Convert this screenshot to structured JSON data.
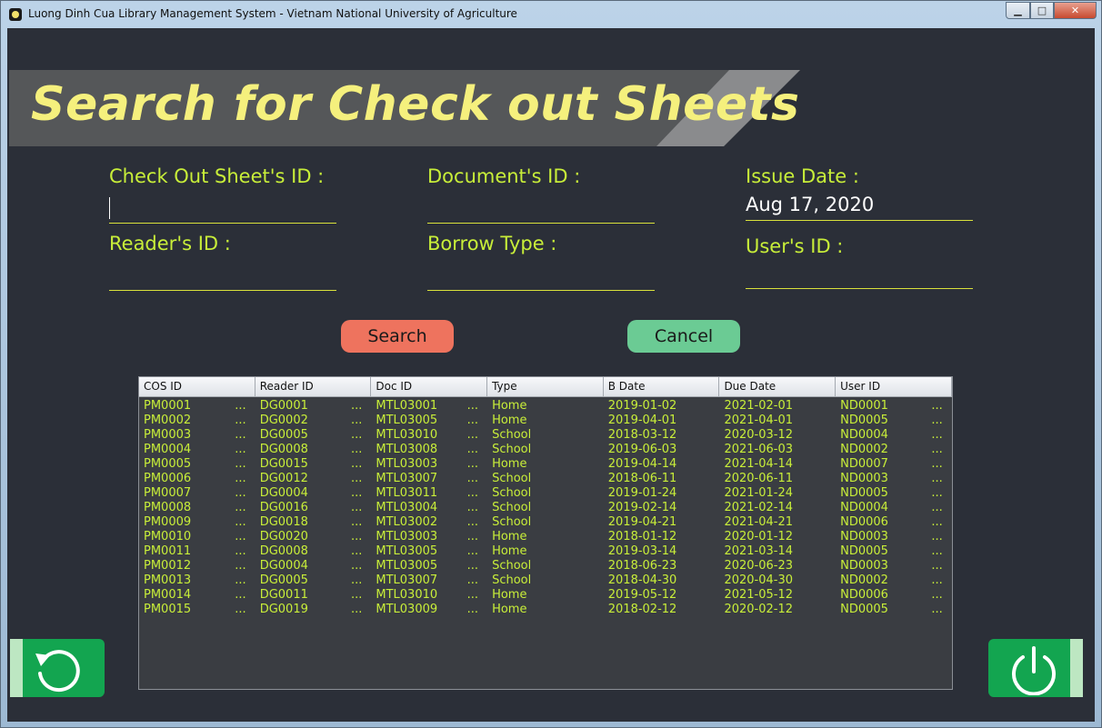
{
  "window": {
    "title": "Luong Dinh Cua Library Management System - Vietnam National University of Agriculture",
    "controls": [
      "minimize",
      "maximize",
      "close"
    ]
  },
  "banner": {
    "title": "Search for Check out Sheets"
  },
  "form": {
    "checkout_id_label": "Check Out Sheet's ID :",
    "checkout_id_value": "",
    "document_id_label": "Document's ID :",
    "document_id_value": "",
    "issue_date_label": "Issue Date :",
    "issue_date_value": "Aug 17, 2020",
    "reader_id_label": "Reader's ID :",
    "reader_id_value": "",
    "borrow_type_label": "Borrow Type :",
    "borrow_type_value": "",
    "user_id_label": "User's ID :",
    "user_id_value": ""
  },
  "buttons": {
    "search": "Search",
    "cancel": "Cancel",
    "back_icon": "undo-icon",
    "exit_icon": "power-icon"
  },
  "table": {
    "columns": [
      "COS ID",
      "Reader ID",
      "Doc ID",
      "Type",
      "B Date",
      "Due Date",
      "User ID"
    ],
    "rows": [
      [
        "PM0001",
        "DG0001",
        "MTL03001",
        "Home",
        "2019-01-02",
        "2021-02-01",
        "ND0001"
      ],
      [
        "PM0002",
        "DG0002",
        "MTL03005",
        "Home",
        "2019-04-01",
        "2021-04-01",
        "ND0005"
      ],
      [
        "PM0003",
        "DG0005",
        "MTL03010",
        "School",
        "2018-03-12",
        "2020-03-12",
        "ND0004"
      ],
      [
        "PM0004",
        "DG0008",
        "MTL03008",
        "School",
        "2019-06-03",
        "2021-06-03",
        "ND0002"
      ],
      [
        "PM0005",
        "DG0015",
        "MTL03003",
        "Home",
        "2019-04-14",
        "2021-04-14",
        "ND0007"
      ],
      [
        "PM0006",
        "DG0012",
        "MTL03007",
        "School",
        "2018-06-11",
        "2020-06-11",
        "ND0003"
      ],
      [
        "PM0007",
        "DG0004",
        "MTL03011",
        "School",
        "2019-01-24",
        "2021-01-24",
        "ND0005"
      ],
      [
        "PM0008",
        "DG0016",
        "MTL03004",
        "School",
        "2019-02-14",
        "2021-02-14",
        "ND0004"
      ],
      [
        "PM0009",
        "DG0018",
        "MTL03002",
        "School",
        "2019-04-21",
        "2021-04-21",
        "ND0006"
      ],
      [
        "PM0010",
        "DG0020",
        "MTL03003",
        "Home",
        "2018-01-12",
        "2020-01-12",
        "ND0003"
      ],
      [
        "PM0011",
        "DG0008",
        "MTL03005",
        "Home",
        "2019-03-14",
        "2021-03-14",
        "ND0005"
      ],
      [
        "PM0012",
        "DG0004",
        "MTL03005",
        "School",
        "2018-06-23",
        "2020-06-23",
        "ND0003"
      ],
      [
        "PM0013",
        "DG0005",
        "MTL03007",
        "School",
        "2018-04-30",
        "2020-04-30",
        "ND0002"
      ],
      [
        "PM0014",
        "DG0011",
        "MTL03010",
        "Home",
        "2019-05-12",
        "2021-05-12",
        "ND0006"
      ],
      [
        "PM0015",
        "DG0019",
        "MTL03009",
        "Home",
        "2018-02-12",
        "2020-02-12",
        "ND0005"
      ]
    ]
  },
  "colors": {
    "background": "#2b2f38",
    "label": "#c8ee39",
    "banner_text": "#f5f07d",
    "search_button": "#ee735e",
    "cancel_button": "#6bcb94",
    "side_button": "#13a550"
  }
}
